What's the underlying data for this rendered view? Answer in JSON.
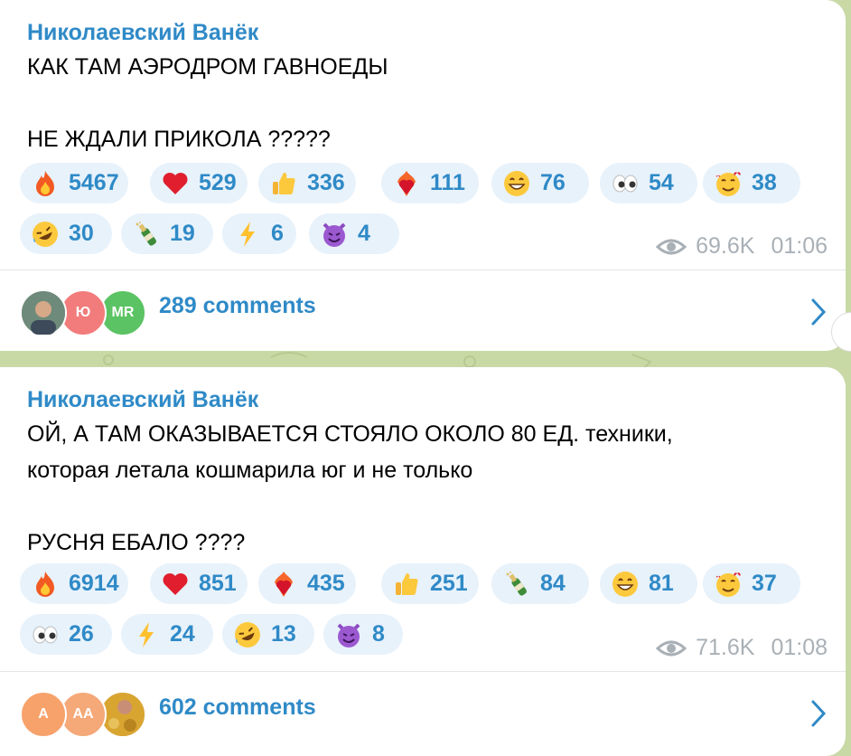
{
  "messages": [
    {
      "author": "Николаевский Ванёк",
      "text": "КАК ТАМ АЭРОДРОМ ГАВНОЕДЫ\n\nНЕ ЖДАЛИ ПРИКОЛА ?????",
      "reactions_row1": [
        {
          "emoji": "fire-emoji",
          "count": "5467"
        },
        {
          "emoji": "heart-emoji",
          "count": "529"
        },
        {
          "emoji": "thumbs-up-emoji",
          "count": "336"
        },
        {
          "emoji": "heart-on-fire-emoji",
          "count": "111"
        },
        {
          "emoji": "grinning-emoji",
          "count": "76"
        },
        {
          "emoji": "eyes-emoji",
          "count": "54"
        },
        {
          "emoji": "smiling-hearts-emoji",
          "count": "38"
        }
      ],
      "reactions_row2": [
        {
          "emoji": "rofl-emoji",
          "count": "30"
        },
        {
          "emoji": "champagne-emoji",
          "count": "19"
        },
        {
          "emoji": "lightning-emoji",
          "count": "6"
        },
        {
          "emoji": "smiling-devil-emoji",
          "count": "4"
        }
      ],
      "views": "69.6K",
      "time": "01:06",
      "avatars": [
        "",
        "Ю",
        "MR"
      ],
      "comments": "289 comments"
    },
    {
      "author": "Николаевский Ванёк",
      "text": "ОЙ, А ТАМ ОКАЗЫВАЕТСЯ СТОЯЛО ОКОЛО 80 ЕД. техники,\nкоторая летала кошмарила юг и не только\n\nРУСНЯ ЕБАЛО ????",
      "reactions_row1": [
        {
          "emoji": "fire-emoji",
          "count": "6914"
        },
        {
          "emoji": "heart-emoji",
          "count": "851"
        },
        {
          "emoji": "heart-on-fire-emoji",
          "count": "435"
        },
        {
          "emoji": "thumbs-up-emoji",
          "count": "251"
        },
        {
          "emoji": "champagne-emoji",
          "count": "84"
        },
        {
          "emoji": "grinning-emoji",
          "count": "81"
        },
        {
          "emoji": "smiling-hearts-emoji",
          "count": "37"
        }
      ],
      "reactions_row2": [
        {
          "emoji": "eyes-emoji",
          "count": "26"
        },
        {
          "emoji": "lightning-emoji",
          "count": "24"
        },
        {
          "emoji": "rofl-emoji",
          "count": "13"
        },
        {
          "emoji": "smiling-devil-emoji",
          "count": "8"
        }
      ],
      "views": "71.6K",
      "time": "01:08",
      "avatars": [
        "A",
        "AA",
        ""
      ],
      "comments": "602 comments"
    }
  ],
  "colors": {
    "accent": "#2f8ac7",
    "reaction_bg": "#e8f2fb",
    "meta": "#a9b0b6",
    "chat_bg": "#c9d9a6"
  }
}
